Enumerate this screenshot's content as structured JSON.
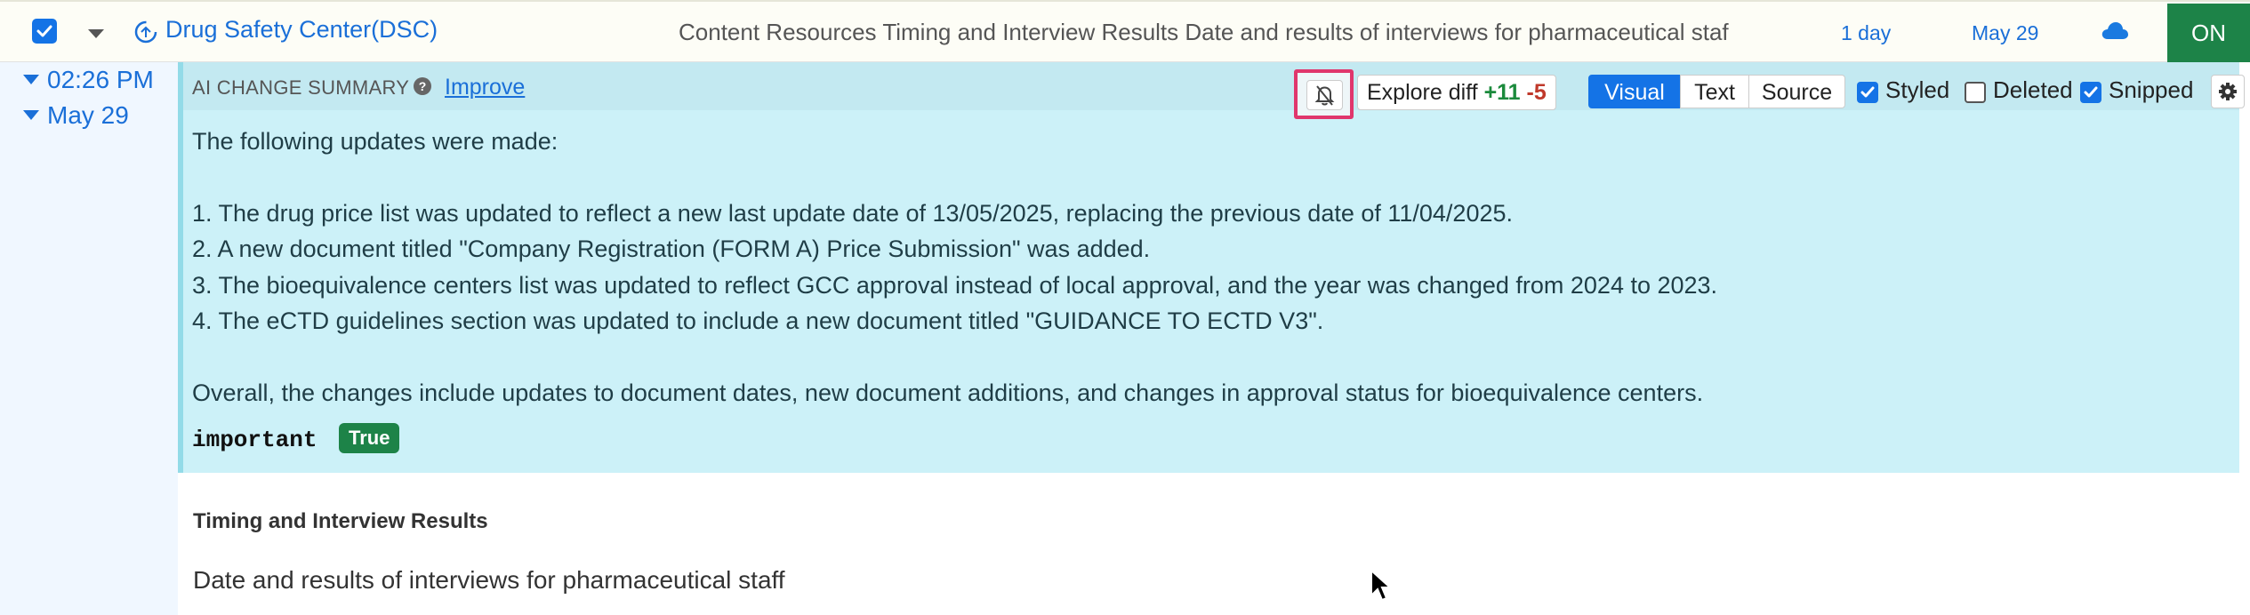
{
  "row": {
    "site_name": "Drug Safety Center(DSC)",
    "title": "Content Resources Timing and Interview Results Date and results of interviews for pharmaceutical staf",
    "frequency": "1 day",
    "date": "May 29",
    "toggle_label": "ON"
  },
  "timeline": {
    "time": "02:26 PM",
    "date": "May 29"
  },
  "summary": {
    "label": "AI CHANGE SUMMARY",
    "improve_label": "Improve",
    "toolbar": {
      "explore_label": "Explore diff",
      "added": "+11",
      "removed": "-5",
      "view_modes": [
        "Visual",
        "Text",
        "Source"
      ],
      "active_view": "Visual",
      "options": [
        {
          "label": "Styled",
          "checked": true
        },
        {
          "label": "Deleted",
          "checked": false
        },
        {
          "label": "Snipped",
          "checked": true
        }
      ]
    },
    "lines": [
      "The following updates were made:",
      "1. The drug price list was updated to reflect a new last update date of 13/05/2025, replacing the previous date of 11/04/2025.",
      "2. A new document titled \"Company Registration (FORM A) Price Submission\" was added.",
      "3. The bioequivalence centers list was updated to reflect GCC approval instead of local approval, and the year was changed from 2024 to 2023.",
      "4. The eCTD guidelines section was updated to include a new document titled \"GUIDANCE TO ECTD V3\".",
      "Overall, the changes include updates to document dates, new document additions, and changes in approval status for bioequivalence centers."
    ],
    "important_key": "important",
    "important_value": "True"
  },
  "content": {
    "heading": "Timing and Interview Results",
    "text": "Date and results of interviews for pharmaceutical staff"
  },
  "colors": {
    "accent": "#1473e6",
    "link": "#1a6fd8",
    "on_green": "#1d8348",
    "panel_bg": "#ccf1f8",
    "highlight": "#e0366c"
  }
}
